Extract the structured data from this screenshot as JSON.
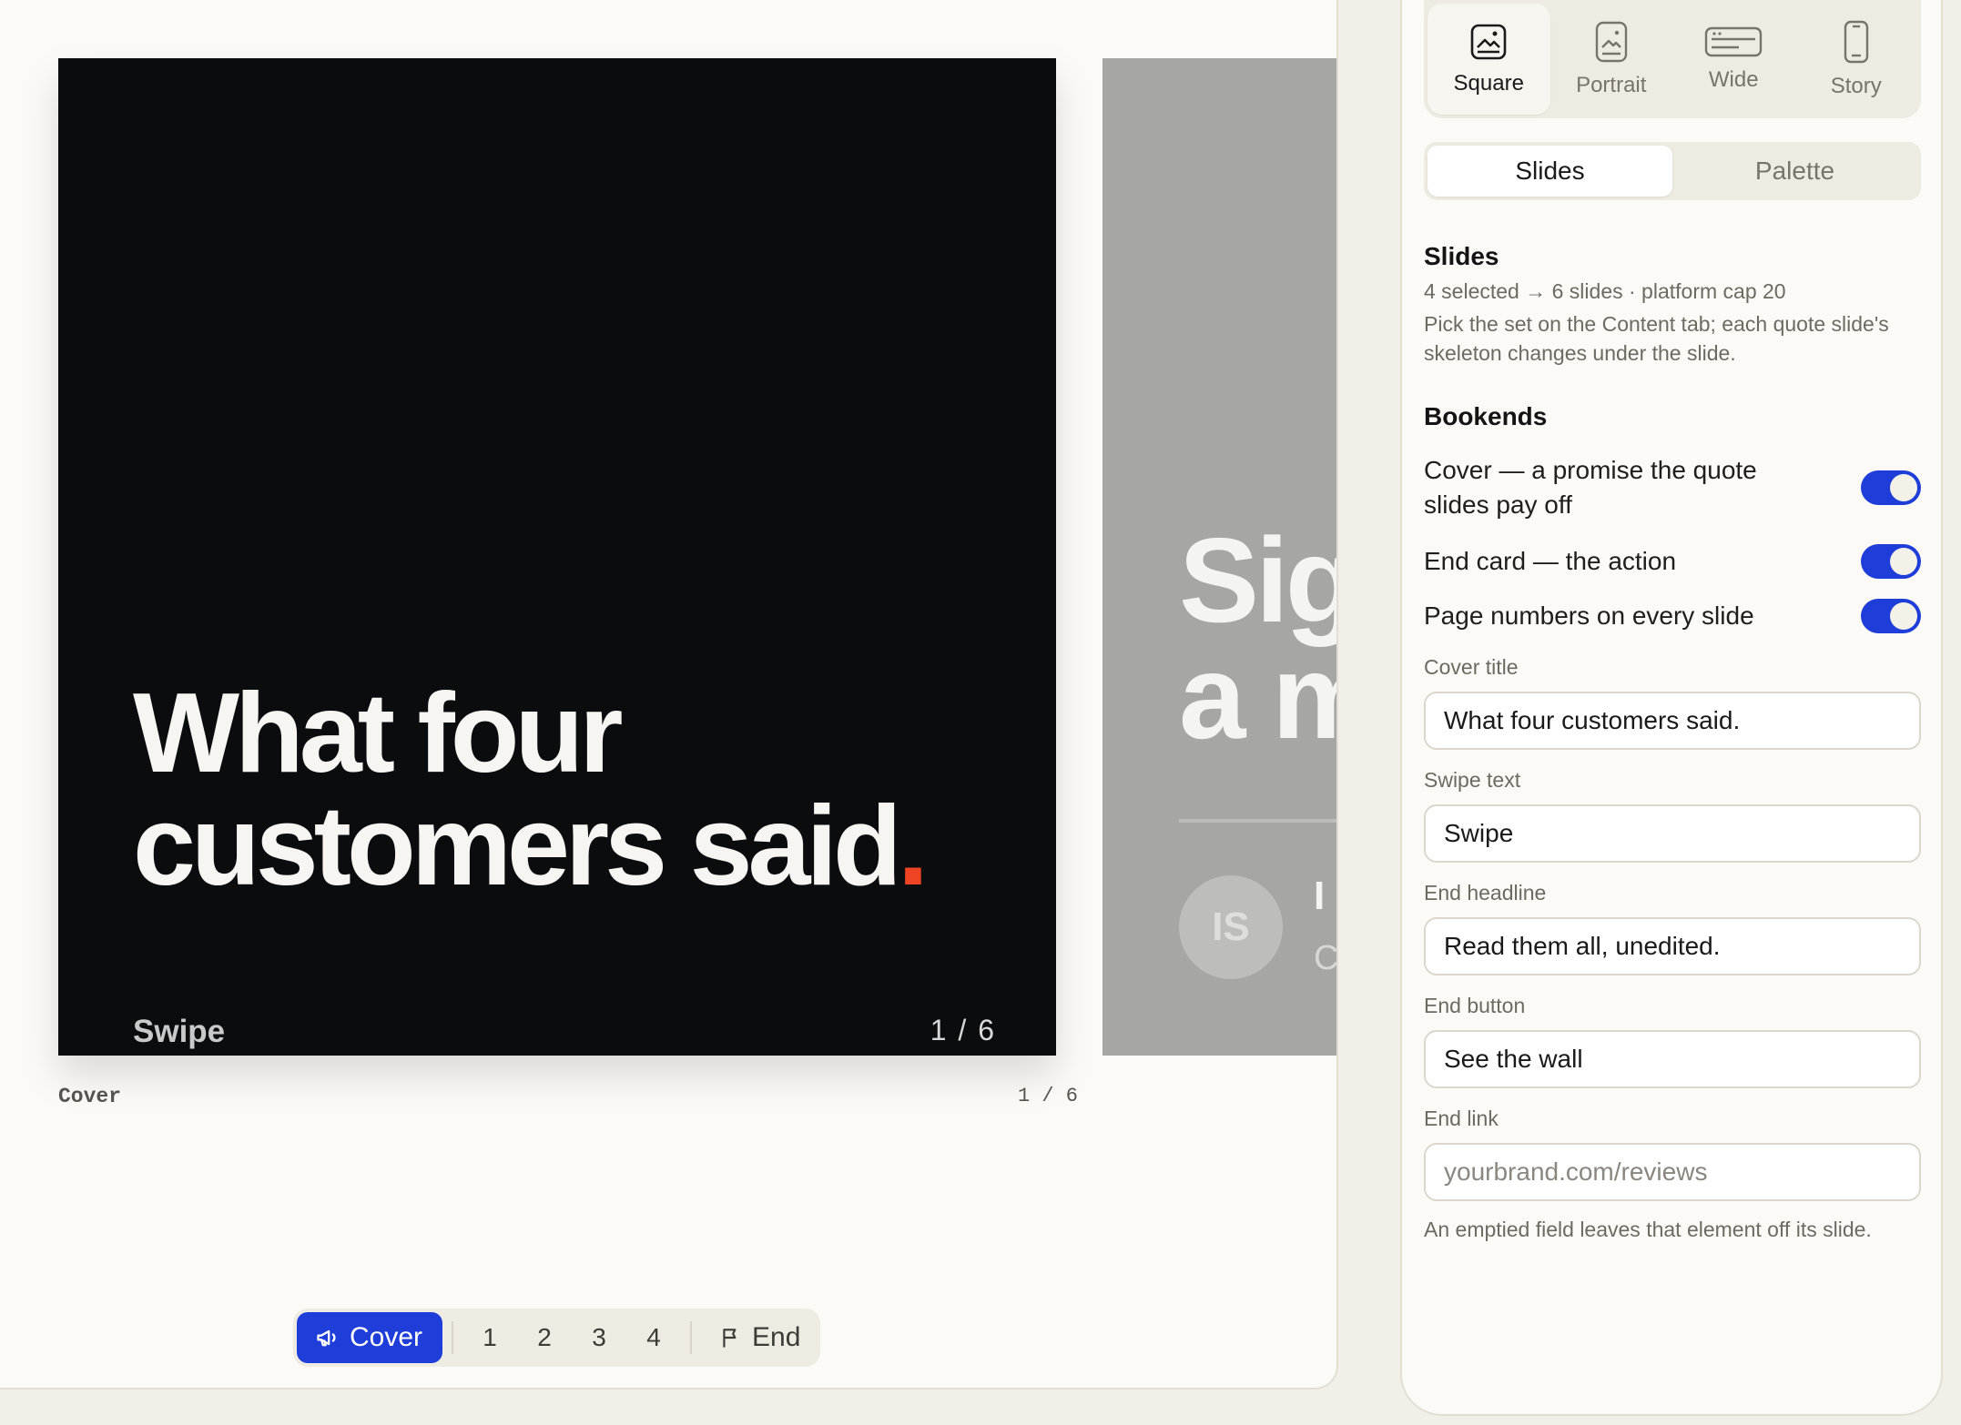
{
  "canvas": {
    "slide": {
      "title_line1": "What four",
      "title_line2": "customers said",
      "title_dot": ".",
      "swipe": "Swipe",
      "page": "1 / 6"
    },
    "caption_left": "Cover",
    "caption_right": "1 / 6",
    "next_slide": {
      "heading_line1": "Sig",
      "heading_line2": "a m",
      "avatar": "IS",
      "name": "I",
      "role": "C"
    }
  },
  "pager": {
    "cover_label": "Cover",
    "numbers": [
      "1",
      "2",
      "3",
      "4"
    ],
    "end_label": "End"
  },
  "panel": {
    "formats": [
      {
        "label": "Square",
        "icon": "square-format-icon",
        "active": true
      },
      {
        "label": "Portrait",
        "icon": "portrait-format-icon",
        "active": false
      },
      {
        "label": "Wide",
        "icon": "wide-format-icon",
        "active": false
      },
      {
        "label": "Story",
        "icon": "story-format-icon",
        "active": false
      }
    ],
    "tabs": {
      "slides": "Slides",
      "palette": "Palette"
    },
    "slides_section": {
      "title": "Slides",
      "meta": "4 selected → 6 slides · platform cap 20",
      "help": "Pick the set on the Content tab; each quote slide's skeleton changes under the slide."
    },
    "bookends": {
      "title": "Bookends",
      "toggles": [
        {
          "label": "Cover — a promise the quote slides pay off",
          "on": true
        },
        {
          "label": "End card — the action",
          "on": true
        },
        {
          "label": "Page numbers on every slide",
          "on": true
        }
      ]
    },
    "fields": {
      "cover_title": {
        "label": "Cover title",
        "value": "What four customers said."
      },
      "swipe_text": {
        "label": "Swipe text",
        "value": "Swipe"
      },
      "end_headline": {
        "label": "End headline",
        "value": "Read them all, unedited."
      },
      "end_button": {
        "label": "End button",
        "value": "See the wall"
      },
      "end_link": {
        "label": "End link",
        "value": "",
        "placeholder": "yourbrand.com/reviews"
      }
    },
    "footnote": "An emptied field leaves that element off its slide."
  },
  "colors": {
    "accent": "#1f3dd8",
    "title_dot": "#ef4423",
    "slide_bg": "#0b0c0e"
  }
}
